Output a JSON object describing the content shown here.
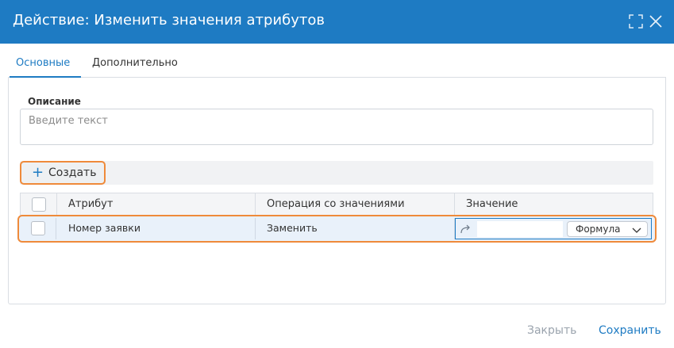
{
  "dialog": {
    "title": "Действие: Изменить значения атрибутов"
  },
  "tabs": [
    {
      "label": "Основные",
      "active": true
    },
    {
      "label": "Дополнительно",
      "active": false
    }
  ],
  "description": {
    "label": "Описание",
    "placeholder": "Введите текст",
    "value": ""
  },
  "toolbar": {
    "create_label": "Создать",
    "create_icon": "plus-icon"
  },
  "table": {
    "columns": [
      "Атрибут",
      "Операция со значениями",
      "Значение"
    ],
    "rows": [
      {
        "attribute": "Номер заявки",
        "operation": "Заменить",
        "value": "",
        "value_mode": "Формула",
        "checked": false
      }
    ]
  },
  "footer": {
    "close_label": "Закрыть",
    "save_label": "Сохранить"
  },
  "colors": {
    "accent": "#1e7bc3",
    "highlight": "#ef8a3a",
    "disabled_text": "#9aa3ad"
  }
}
